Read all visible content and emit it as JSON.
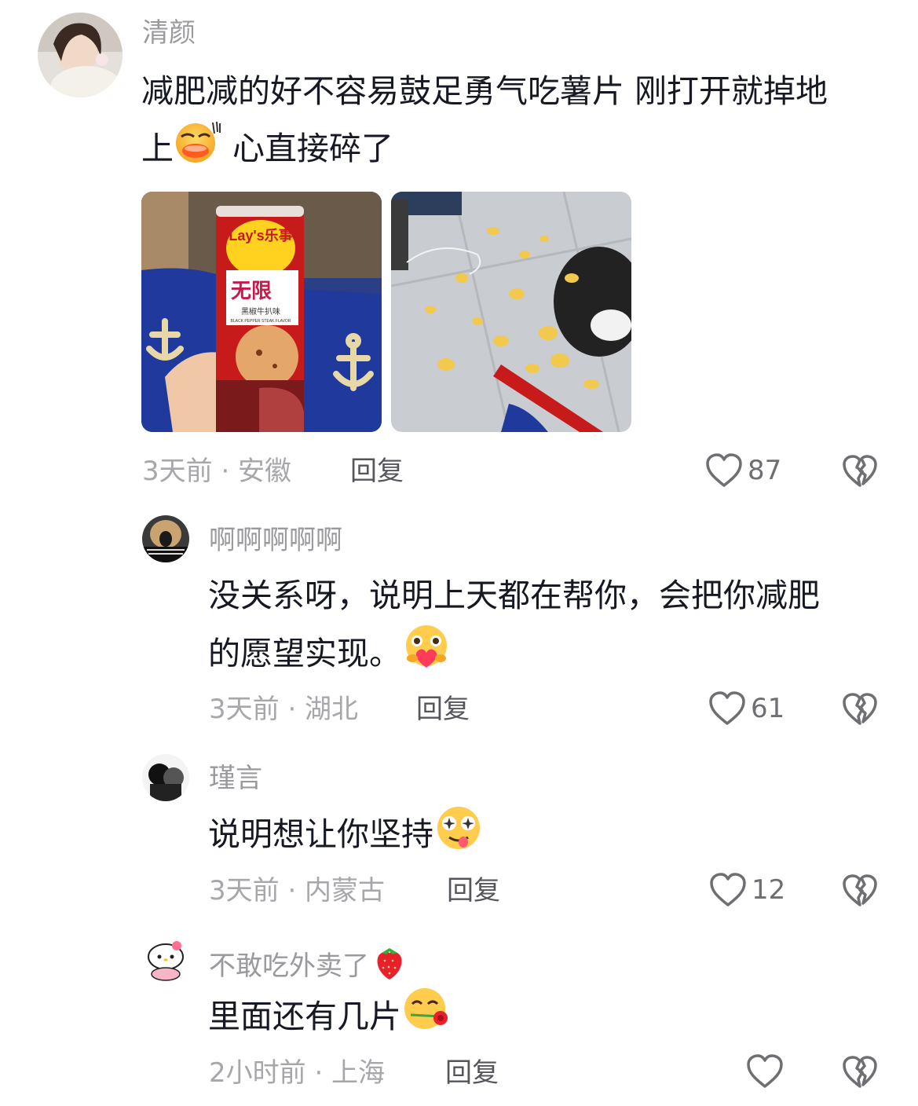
{
  "comments": [
    {
      "username": "清颜",
      "text_line1": "减肥减的好不容易鼓足勇气吃薯片 刚打开就掉地",
      "text_line2_a": "上",
      "text_line2_b": " 心直接碎了",
      "can_brand": "Lay's乐事",
      "can_flavor": "无限",
      "can_sub": "黑椒牛扒味",
      "can_sub_en": "BLACK PEPPER STEAK FLAVOR",
      "meta": "3天前 · 安徽",
      "reply": "回复",
      "likes": "87"
    },
    {
      "username": "啊啊啊啊啊",
      "text_line1": "没关系呀，说明上天都在帮你，会把你减肥",
      "text_line2": "的愿望实现。",
      "meta": "3天前 · 湖北",
      "reply": "回复",
      "likes": "61"
    },
    {
      "username": "瑾言",
      "text_line1": "说明想让你坚持",
      "meta": "3天前 · 内蒙古",
      "reply": "回复",
      "likes": "12"
    },
    {
      "username": "不敢吃外卖了",
      "text_line1": "里面还有几片",
      "meta": "2小时前 · 上海",
      "reply": "回复",
      "likes": ""
    }
  ],
  "icons": {
    "like": "heart-outline-icon",
    "dislike": "broken-heart-icon"
  }
}
